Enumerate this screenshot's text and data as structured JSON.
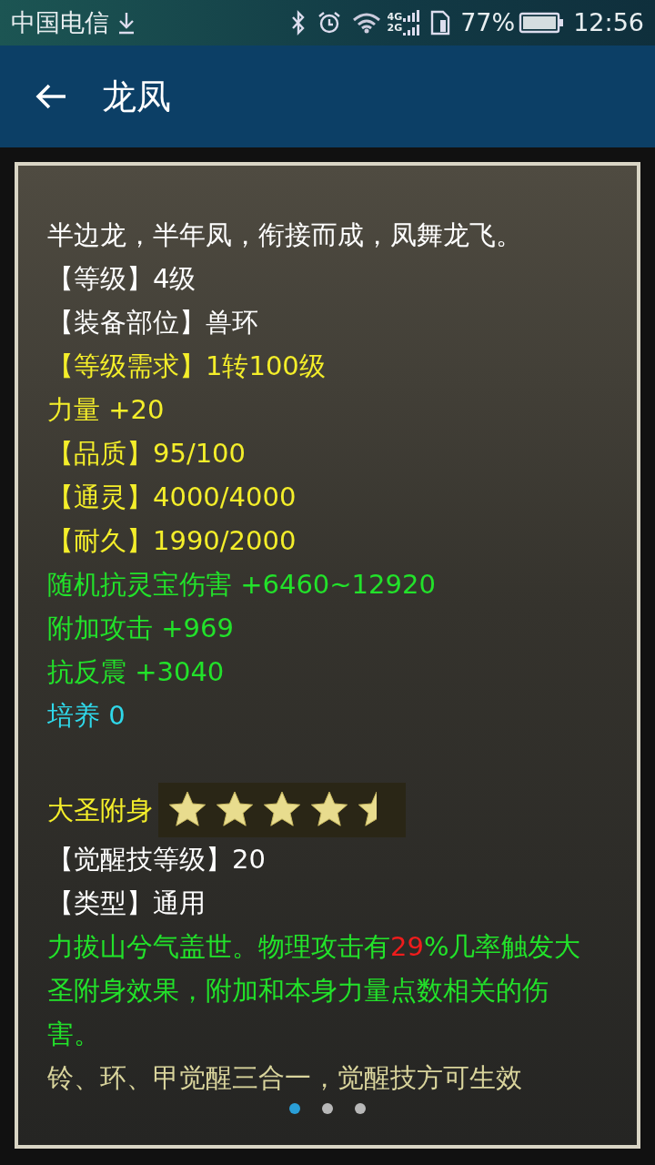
{
  "status_bar": {
    "carrier": "中国电信",
    "network_top": "4G",
    "network_bottom": "2G",
    "battery": "77%",
    "time": "12:56"
  },
  "app_bar": {
    "title": "龙凤"
  },
  "sections": [
    {
      "lines": [
        {
          "kind": "text",
          "color": "#ffffff",
          "text": "半边龙，半年凤，衔接而成，凤舞龙飞。"
        },
        {
          "kind": "text",
          "color": "#ffffff",
          "text": "【等级】4级"
        },
        {
          "kind": "text",
          "color": "#ffffff",
          "text": "【装备部位】兽环"
        },
        {
          "kind": "text",
          "color": "#f4ee2a",
          "text": "【等级需求】1转100级"
        },
        {
          "kind": "text",
          "color": "#f4ee2a",
          "text": "力量 +20"
        },
        {
          "kind": "text",
          "color": "#f4ee2a",
          "text": "【品质】95/100"
        },
        {
          "kind": "text",
          "color": "#f4ee2a",
          "text": "【通灵】4000/4000"
        },
        {
          "kind": "text",
          "color": "#f4ee2a",
          "text": "【耐久】1990/2000"
        },
        {
          "kind": "text",
          "color": "#22e22a",
          "text": "随机抗灵宝伤害 +6460~12920"
        },
        {
          "kind": "text",
          "color": "#22e22a",
          "text": "附加攻击 +969"
        },
        {
          "kind": "text",
          "color": "#22e22a",
          "text": "抗反震 +3040"
        },
        {
          "kind": "text",
          "color": "#2fd8ea",
          "text": "培养 0"
        }
      ]
    },
    {
      "lines": [
        {
          "kind": "stars",
          "color": "#f4ee2a",
          "text": "大圣附身",
          "stars": 4.5
        },
        {
          "kind": "text",
          "color": "#ffffff",
          "text": "【觉醒技等级】20"
        },
        {
          "kind": "text",
          "color": "#ffffff",
          "text": "【类型】通用"
        },
        {
          "kind": "parts",
          "parts": [
            {
              "color": "#22e22a",
              "text": "力拔山兮气盖世。物理攻击有"
            },
            {
              "color": "#f01c1c",
              "text": "29"
            },
            {
              "color": "#22e22a",
              "text": "%几率触发大圣附身效果，附加和本身力量点数相关的伤害。"
            }
          ]
        },
        {
          "kind": "text",
          "color": "#d9d49c",
          "text": "铃、环、甲觉醒三合一，觉醒技方可生效"
        }
      ]
    }
  ],
  "pages": [
    {
      "selected": true
    },
    {
      "selected": false
    },
    {
      "selected": false
    }
  ]
}
